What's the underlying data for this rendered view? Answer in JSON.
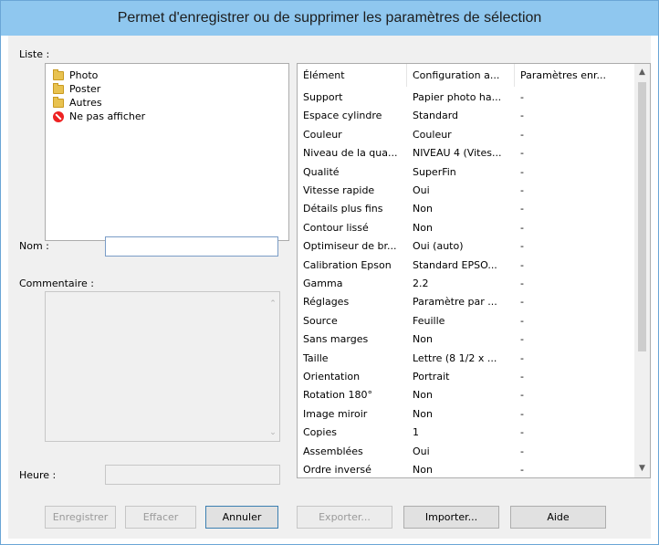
{
  "window": {
    "title": "Permet d'enregistrer ou de supprimer les paramètres de sélection"
  },
  "left": {
    "list_label": "Liste :",
    "list_items": [
      {
        "label": "Photo",
        "icon": "folder-icon"
      },
      {
        "label": "Poster",
        "icon": "folder-icon"
      },
      {
        "label": "Autres",
        "icon": "folder-icon"
      },
      {
        "label": "Ne pas afficher",
        "icon": "no-entry-icon"
      }
    ],
    "name_label": "Nom :",
    "name_value": "",
    "comment_label": "Commentaire :",
    "time_label": "Heure :",
    "time_value": ""
  },
  "table": {
    "headers": [
      "Élément",
      "Configuration a...",
      "Paramètres enr..."
    ],
    "rows": [
      [
        "Support",
        "Papier photo ha...",
        "-"
      ],
      [
        "Espace cylindre",
        "Standard",
        "-"
      ],
      [
        "Couleur",
        "Couleur",
        "-"
      ],
      [
        "Niveau de la qua...",
        "NIVEAU 4 (Vites...",
        "-"
      ],
      [
        "Qualité",
        "SuperFin",
        "-"
      ],
      [
        "Vitesse rapide",
        "Oui",
        "-"
      ],
      [
        "Détails plus fins",
        "Non",
        "-"
      ],
      [
        "Contour lissé",
        "Non",
        "-"
      ],
      [
        "Optimiseur de br...",
        "Oui (auto)",
        "-"
      ],
      [
        "Calibration Epson",
        "Standard EPSO...",
        "-"
      ],
      [
        "Gamma",
        "2.2",
        "-"
      ],
      [
        "Réglages",
        "Paramètre par ...",
        "-"
      ],
      [
        "Source",
        "Feuille",
        "-"
      ],
      [
        "Sans marges",
        "Non",
        "-"
      ],
      [
        "Taille",
        "Lettre (8 1/2 x ...",
        "-"
      ],
      [
        "Orientation",
        "Portrait",
        "-"
      ],
      [
        "Rotation 180°",
        "Non",
        "-"
      ],
      [
        "Image miroir",
        "Non",
        "-"
      ],
      [
        "Copies",
        "1",
        "-"
      ],
      [
        "Assemblées",
        "Oui",
        "-"
      ],
      [
        "Ordre inversé",
        "Non",
        "-"
      ]
    ]
  },
  "buttons": {
    "save": "Enregistrer",
    "delete": "Effacer",
    "cancel": "Annuler",
    "export": "Exporter...",
    "import": "Importer...",
    "help": "Aide"
  },
  "colors": {
    "title_bar": "#8fc7ef",
    "dialog_bg": "#f0f0f0",
    "disabled_text": "#9a9a9a"
  }
}
